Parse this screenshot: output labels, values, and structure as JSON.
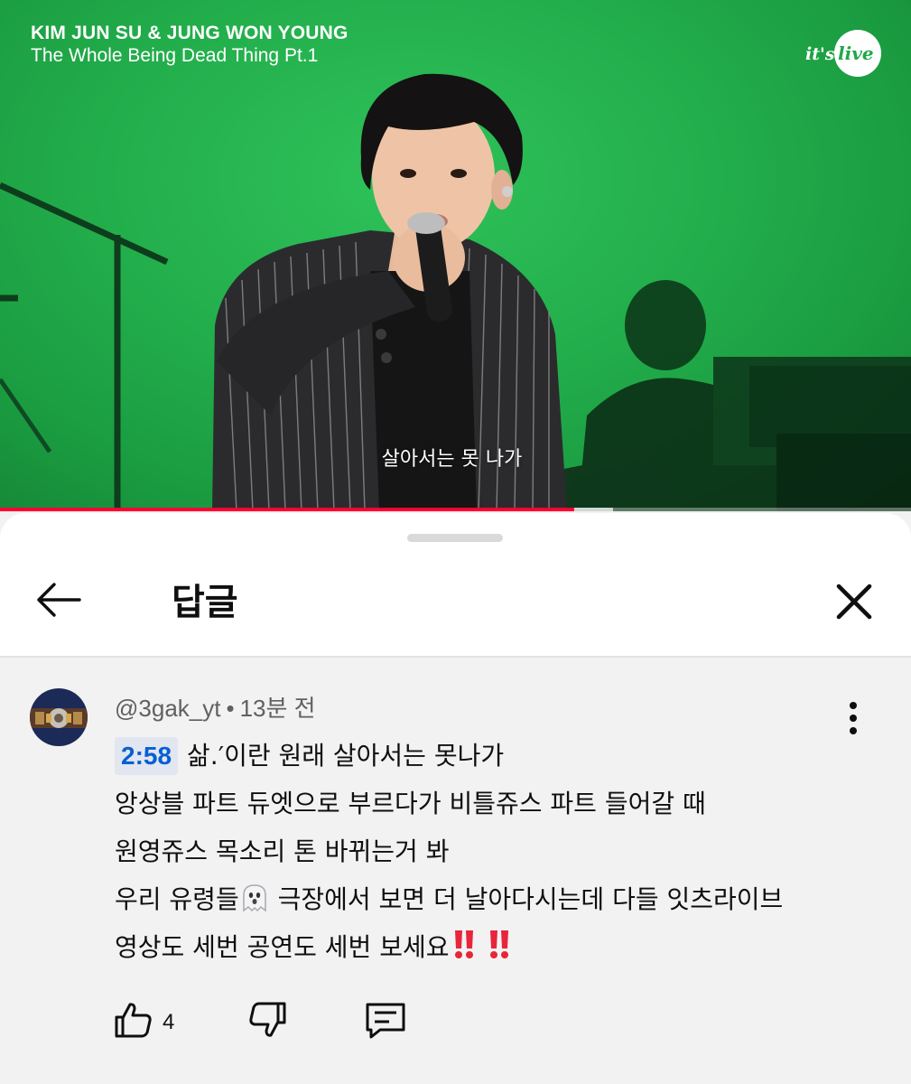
{
  "video": {
    "title_line1": "KIM JUN SU & JUNG WON YOUNG",
    "title_line2": "The Whole Being Dead Thing Pt.1",
    "logo_text": "it's live",
    "subtitle": "살아서는 못 나가",
    "progress_fraction": 0.63,
    "buffer_fraction": 0.673,
    "accent_color": "#ff0033"
  },
  "sheet": {
    "title": "답글",
    "back_icon": "arrow-left-icon",
    "close_icon": "close-icon"
  },
  "comment": {
    "handle": "@3gak_yt",
    "separator": "•",
    "time_ago": "13분 전",
    "timestamp": "2:58",
    "lines": [
      "삶.′이란 원래 살아서는 못나가",
      "앙상블 파트 듀엣으로 부르다가 비틀쥬스 파트 들어갈 때",
      "원영쥬스 목소리 톤 바뀌는거 봐",
      "우리 유령들",
      " 극장에서 보면 더 날아다시는데 다들 잇츠라이브",
      "영상도 세번 공연도 세번 보세요"
    ],
    "like_count": "4",
    "icons": {
      "like": "thumbs-up-icon",
      "dislike": "thumbs-down-icon",
      "reply": "reply-icon",
      "more": "more-vert-icon",
      "ghost": "ghost-emoji",
      "exclamation": "double-exclamation-emoji"
    }
  }
}
